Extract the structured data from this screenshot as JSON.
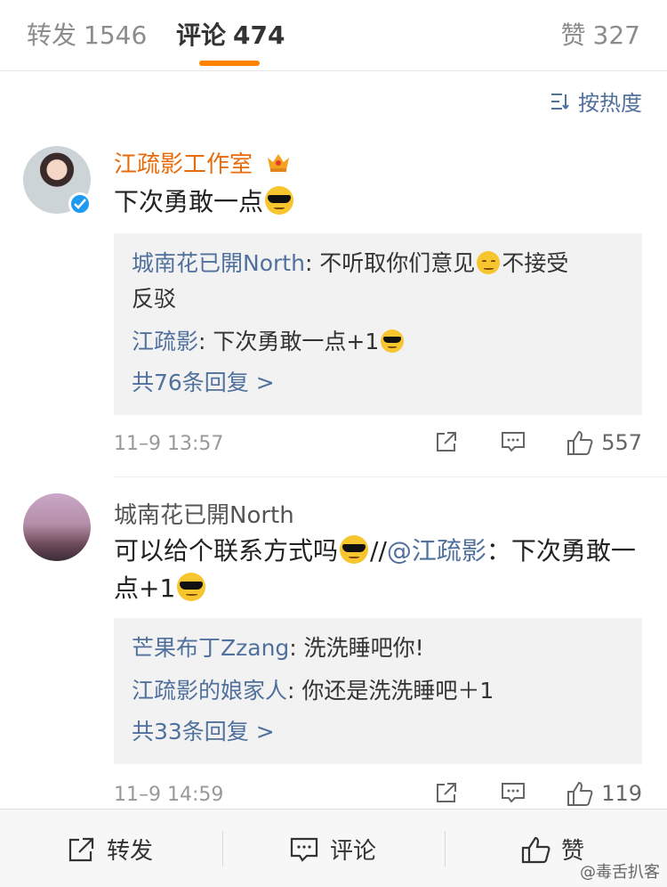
{
  "tabs": {
    "repost": {
      "label": "转发",
      "count": "1546"
    },
    "comment": {
      "label": "评论",
      "count": "474"
    },
    "like": {
      "label": "赞",
      "count": "327"
    }
  },
  "sort": {
    "label": "按热度"
  },
  "comments": [
    {
      "name": "江疏影工作室",
      "text": "下次勇敢一点",
      "replies": [
        {
          "name": "城南花已開North",
          "text": ": 不听取你们意见",
          "text2": "不接受",
          "text3": "反驳"
        },
        {
          "name": "江疏影",
          "text": ": 下次勇敢一点+1"
        }
      ],
      "more": "共76条回复 >",
      "time": "11–9 13:57",
      "likes": "557"
    },
    {
      "name": "城南花已開North",
      "text": "可以给个联系方式吗",
      "mention_prefix": "//",
      "mention": "@江疏影",
      "mention_text": "：下次勇敢一点+1",
      "replies": [
        {
          "name": "芒果布丁Zzang",
          "text": ": 洗洗睡吧你!"
        },
        {
          "name": "江疏影的娘家人",
          "text": ": 你还是洗洗睡吧＋1"
        }
      ],
      "more": "共33条回复 >",
      "time": "11–9 14:59",
      "likes": "119"
    }
  ],
  "bottombar": {
    "repost": "转发",
    "comment": "评论",
    "like": "赞",
    "watermark": "@毒舌扒客"
  },
  "colors": {
    "accent": "#ff8200",
    "link": "#50709d",
    "vipName": "#e86b0c"
  }
}
